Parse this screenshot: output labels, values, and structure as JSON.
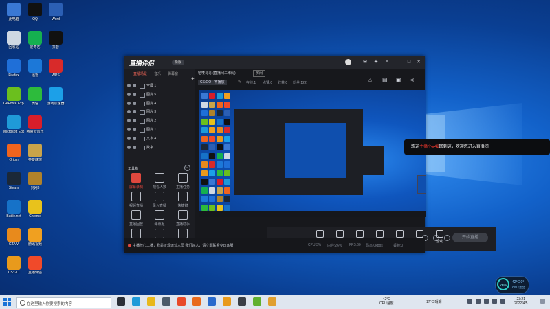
{
  "desktop": {
    "icons": [
      {
        "label": "此电脑",
        "color": "#3a78d4"
      },
      {
        "label": "回收站",
        "color": "#cfd8e3"
      },
      {
        "label": "Firefox",
        "color": "#1f6fd8"
      },
      {
        "label": "GeForce Experience",
        "color": "#6bbf1e"
      },
      {
        "label": "Microsoft Edge",
        "color": "#1f9ad8"
      },
      {
        "label": "Origin",
        "color": "#f0641e"
      },
      {
        "label": "Steam",
        "color": "#1b2838"
      },
      {
        "label": "Battle.net",
        "color": "#1672c8"
      },
      {
        "label": "GTA V",
        "color": "#e88a1c"
      },
      {
        "label": "CS:GO",
        "color": "#e89a1c"
      },
      {
        "label": "QQ",
        "color": "#111111"
      },
      {
        "label": "爱奇艺",
        "color": "#15b050"
      },
      {
        "label": "迅雷",
        "color": "#1c78d8"
      },
      {
        "label": "微信",
        "color": "#2dbb3c"
      },
      {
        "label": "网易云音乐",
        "color": "#d81e2a"
      },
      {
        "label": "英雄联盟",
        "color": "#c9a44a"
      },
      {
        "label": "剑网3",
        "color": "#b0822a"
      },
      {
        "label": "Chrome",
        "color": "#e8c21c"
      },
      {
        "label": "腾讯视频",
        "color": "#f0a020"
      },
      {
        "label": "直播伴侣",
        "color": "#f04a2a"
      },
      {
        "label": "Word",
        "color": "#2b5fb4"
      },
      {
        "label": "抖音",
        "color": "#111111"
      },
      {
        "label": "WPS",
        "color": "#d82a2a"
      },
      {
        "label": "游戏加速器",
        "color": "#1ca0e8"
      }
    ]
  },
  "app": {
    "title": "直播伴侣",
    "badge": "新版",
    "left_tabs": [
      "直播场景",
      "音乐",
      "弹幕窗"
    ],
    "sources": [
      "全屏 1",
      "图片 5",
      "图片 4",
      "图片 3",
      "图片 2",
      "图片 1",
      "文本 4",
      "数字"
    ],
    "tools_header": "工具箱",
    "tools": [
      {
        "label": "屏幕录制",
        "highlight": true
      },
      {
        "label": "观看人数",
        "highlight": false
      },
      {
        "label": "主播任务",
        "highlight": false
      },
      {
        "label": "视频直播",
        "highlight": false
      },
      {
        "label": "录入直播",
        "highlight": false
      },
      {
        "label": "快捷键",
        "highlight": false
      },
      {
        "label": "直播回放",
        "highlight": false
      },
      {
        "label": "弹幕姬",
        "highlight": false
      },
      {
        "label": "直播助手",
        "highlight": false
      },
      {
        "label": "礼物",
        "highlight": false
      },
      {
        "label": "",
        "highlight": false
      },
      {
        "label": "",
        "highlight": false
      }
    ],
    "room_info": "哈喽哥哥  (直播间二维码)",
    "room_button": "房间",
    "game_tag": "CS:GO · 不播放",
    "stats": [
      "在线:1",
      "点赞:0",
      "收益:0",
      "粉丝:122"
    ],
    "bottom_items": [
      "直播界面",
      "摄像头",
      "手机投屏",
      "多媒体",
      "麦克风",
      "音响",
      "游戏"
    ],
    "start_live": "开始直播",
    "status_message": "主播放心工播，我是正规运营人员 我们好人，请立即联系今日客服",
    "status_stats": [
      "CPU:3%",
      "内存:26%",
      "FPS:60",
      "码率:0kbps",
      "丢帧:0"
    ]
  },
  "welcome": {
    "pre": "欢迎",
    "highlight": "主播小V42",
    "post": "回到这，欢迎您进入直播间"
  },
  "taskbar": {
    "search_placeholder": "在这里输入你要搜索的内容",
    "apps": [
      {
        "name": "task-view",
        "color": "#2a2f38"
      },
      {
        "name": "edge",
        "color": "#1f9ad8"
      },
      {
        "name": "explorer",
        "color": "#e8b81c"
      },
      {
        "name": "store",
        "color": "#4a5a6a"
      },
      {
        "name": "chrome",
        "color": "#e84a2a"
      },
      {
        "name": "firefox",
        "color": "#e86a1c"
      },
      {
        "name": "qq",
        "color": "#2a6acc"
      },
      {
        "name": "game",
        "color": "#e89a1c"
      },
      {
        "name": "app1",
        "color": "#3a3f47"
      },
      {
        "name": "app2",
        "color": "#60b030"
      },
      {
        "name": "app3",
        "color": "#e0a030"
      }
    ],
    "cpu_temp": "42°C",
    "cpu_temp_label": "CPU温度",
    "weather": "17°C 晴朗",
    "time": "23:21",
    "date": "2022/4/5"
  },
  "perf_widget": {
    "percent": "26%",
    "temp": "42°C 0°",
    "label": "CPU温度"
  }
}
